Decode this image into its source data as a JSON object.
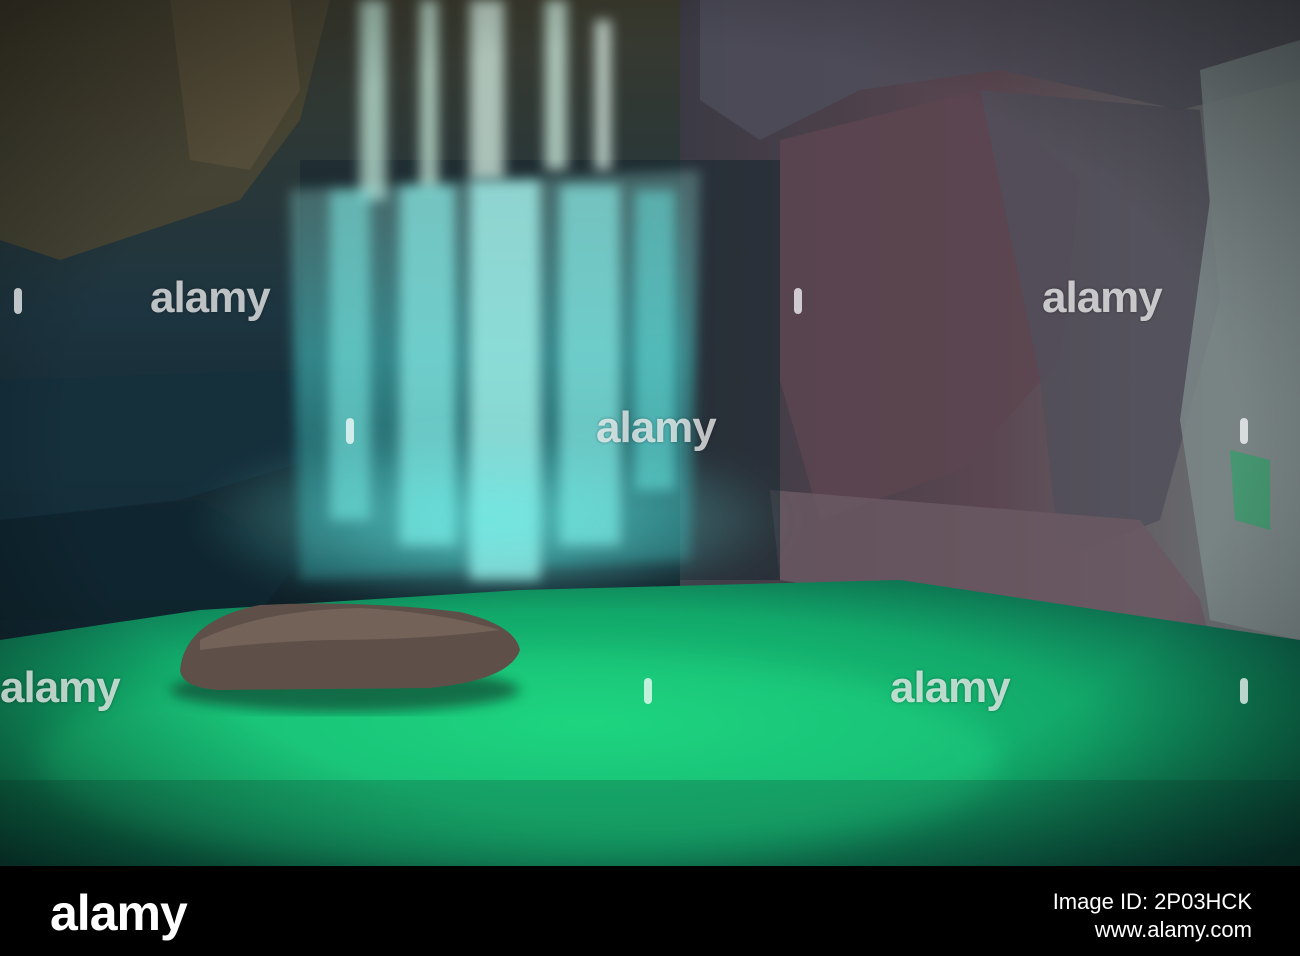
{
  "image": {
    "subject": "cave-waterfall",
    "colors": {
      "water_glow": "#3fe0d8",
      "pool": "#13b36f",
      "rock": "#5a4a52",
      "shadow": "#0c1418"
    }
  },
  "watermark": {
    "text": "alamy"
  },
  "footer": {
    "logo": "alamy",
    "image_id": "Image ID: 2P03HCK",
    "site": "www.alamy.com"
  }
}
